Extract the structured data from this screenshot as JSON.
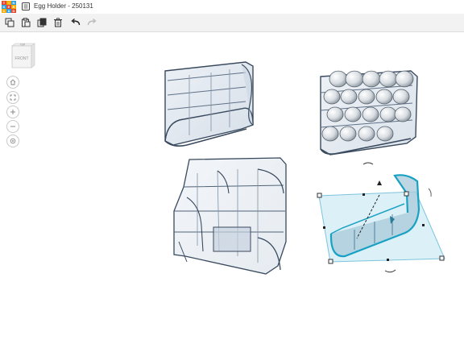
{
  "app": {
    "logo_letters": [
      "T",
      "I",
      "N",
      "K",
      "E",
      "R",
      "C",
      "A",
      "D"
    ],
    "logo_colors": [
      "#e2462c",
      "#f2a900",
      "#2f9ee0",
      "#2f9ee0",
      "#e2462c",
      "#f2a900",
      "#f2a900",
      "#2f9ee0",
      "#e2462c"
    ]
  },
  "title": {
    "document_name": "Egg Holder - 250131"
  },
  "toolbar": {
    "copy_icon": "copy-icon",
    "paste_icon": "paste-icon",
    "duplicate_icon": "duplicate-icon",
    "delete_icon": "trash-icon",
    "undo_icon": "undo-icon",
    "redo_icon": "redo-icon"
  },
  "viewcube": {
    "top_label": "TOP",
    "front_label": "FRONT"
  },
  "nav_controls": [
    "home-view-icon",
    "fit-view-icon",
    "zoom-in-icon",
    "zoom-out-icon",
    "orthographic-icon"
  ],
  "colors": {
    "shape_fill": "#c7d4e3",
    "shape_stroke": "#3a4a5e",
    "selected_stroke": "#19a1c4",
    "selection_plane": "#bfe3f1",
    "toolbar_bg": "#f2f2f2"
  }
}
